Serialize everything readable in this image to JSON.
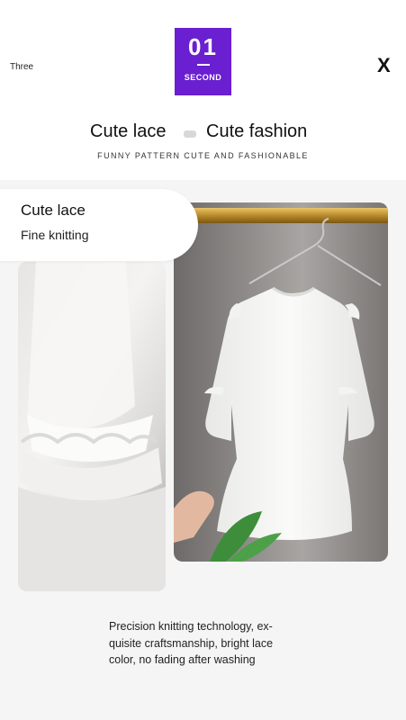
{
  "header": {
    "left_label": "Three",
    "close_symbol": "X",
    "badge_number": "01",
    "badge_label": "SECOND"
  },
  "title": {
    "left": "Cute lace",
    "right": "Cute fashion",
    "subtitle": "FUNNY PATTERN CUTE AND FASHIONABLE"
  },
  "feature": {
    "heading": "Cute lace",
    "subheading": "Fine knitting"
  },
  "description": {
    "line1": "Precision knitting technology, ex-",
    "line2": "quisite craftsmanship, bright lace",
    "line3": "color, no fading after washing"
  },
  "colors": {
    "badge": "#6a1fd0",
    "panel": "#f5f5f5"
  }
}
